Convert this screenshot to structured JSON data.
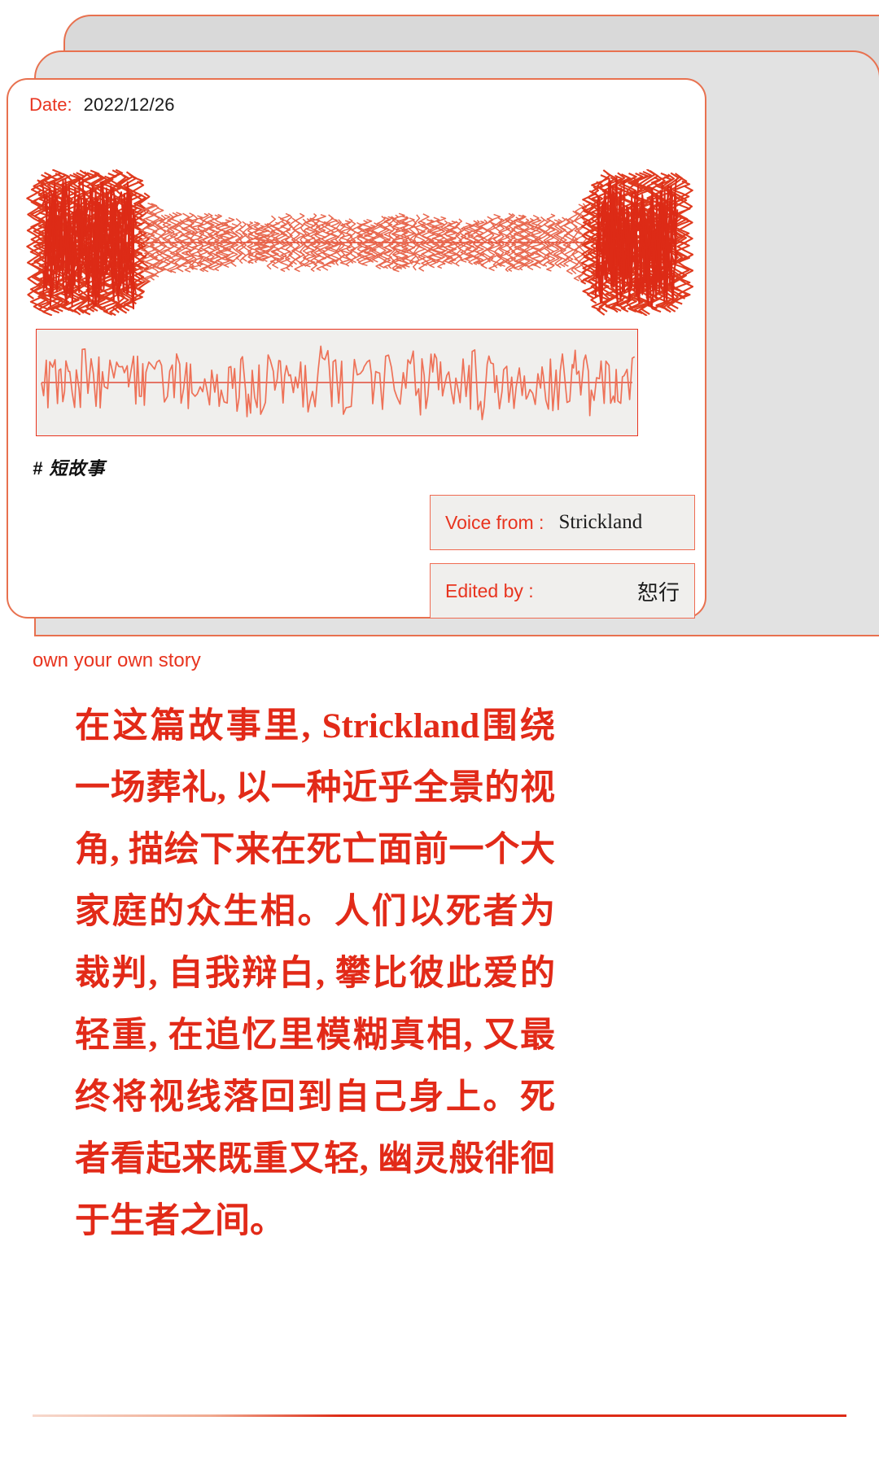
{
  "card": {
    "date_label": "Date:",
    "date_value": "2022/12/26",
    "hashtag": "# 短故事",
    "tagline": "own your own story",
    "credits": [
      {
        "label": "Voice from :",
        "value": "Strickland",
        "align": "left"
      },
      {
        "label": "Edited by :",
        "value": "恕行",
        "align": "right"
      }
    ]
  },
  "story": {
    "paragraph": "在这篇故事里, Strickland围绕一场葬礼, 以一种近乎全景的视角, 描绘下来在死亡面前一个大家庭的众生相。人们以死者为裁判, 自我辩白, 攀比彼此爱的轻重, 在追忆里模糊真相, 又最终将视线落回到自己身上。死者看起来既重又轻, 幽灵般徘徊于生者之间。"
  },
  "colors": {
    "accent_red": "#e8341f",
    "body_red": "#e22a18",
    "wave_red": "#e8684f",
    "panel_grey": "#f0efed",
    "folder_grey": "#d9d9d9",
    "outline": "#e8714f"
  },
  "waveform": {
    "scribble_label": "audio-scribble-waveform",
    "panel_label": "audio-waveform-panel"
  }
}
